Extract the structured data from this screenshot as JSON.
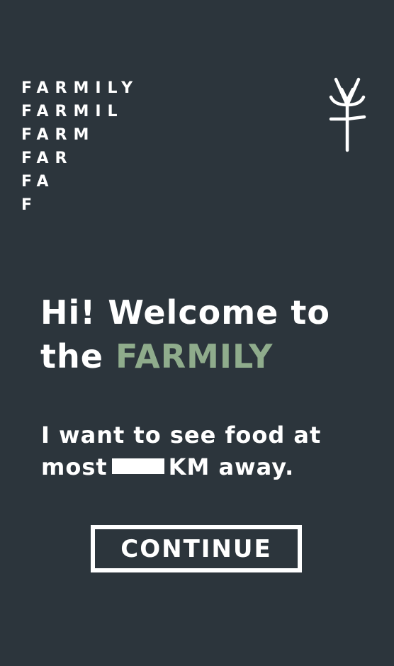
{
  "logo": {
    "lines": [
      "FARMILY",
      "FARMIL",
      "FARM",
      "FAR",
      "FA",
      "F"
    ],
    "mark_icon": "wheat-sprout-icon"
  },
  "welcome": {
    "line1": "Hi! Welcome to",
    "line2_prefix": "the",
    "brand": "FARMILY"
  },
  "distance": {
    "prefix_line1": "I want to see food at",
    "prefix_line2": "most",
    "value": "",
    "suffix": "KM away."
  },
  "continue_button": {
    "label": "CONTINUE"
  },
  "colors": {
    "background": "#2c353c",
    "text": "#ffffff",
    "accent": "#8fac8c"
  }
}
